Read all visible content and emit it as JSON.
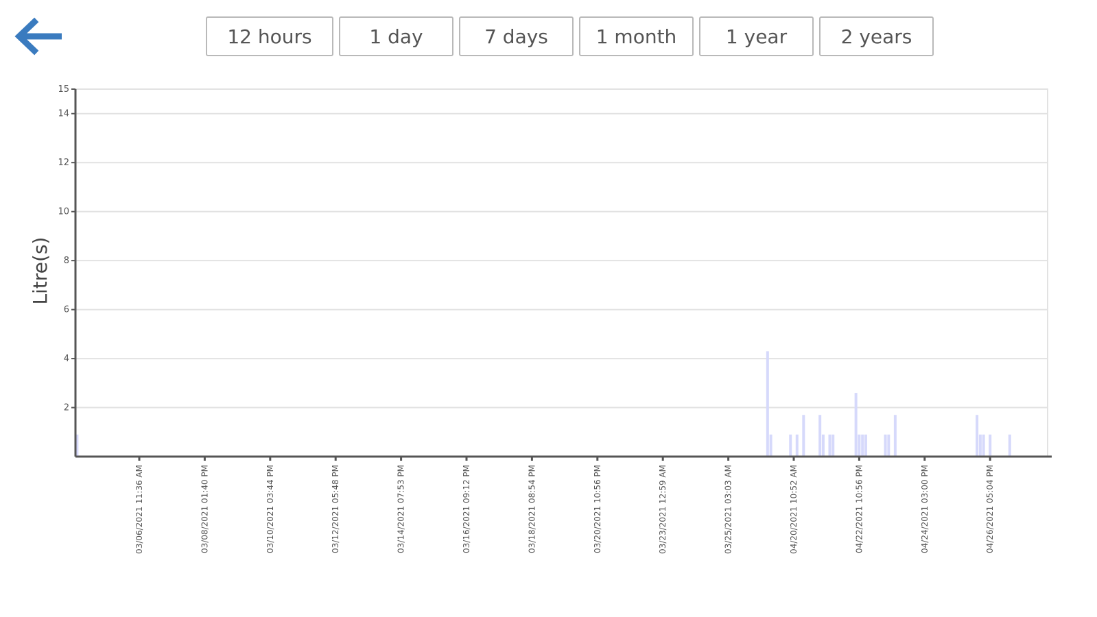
{
  "nav": {
    "back_icon": "arrow-left-icon",
    "back_color": "#3a7bbf"
  },
  "ranges": [
    {
      "label": "12 hours"
    },
    {
      "label": "1 day"
    },
    {
      "label": "7 days"
    },
    {
      "label": "1 month"
    },
    {
      "label": "1 year"
    },
    {
      "label": "2 years"
    }
  ],
  "chart_data": {
    "type": "bar",
    "ylabel": "Litre(s)",
    "ylim": [
      0,
      15
    ],
    "yticks": [
      2,
      4,
      6,
      8,
      10,
      12,
      14,
      15
    ],
    "grid": true,
    "bar_color": "#d6d9fb",
    "xticks": [
      "03/06/2021 11:36 AM",
      "03/08/2021 01:40 PM",
      "03/10/2021 03:44 PM",
      "03/12/2021 05:48 PM",
      "03/14/2021 07:53 PM",
      "03/16/2021 09:12 PM",
      "03/18/2021 08:54 PM",
      "03/20/2021 10:56 PM",
      "03/23/2021 12:59 AM",
      "03/25/2021 03:03 AM",
      "04/20/2021 10:52 AM",
      "04/22/2021 10:56 PM",
      "04/24/2021 03:00 PM",
      "04/26/2021 05:04 PM"
    ],
    "series": [
      {
        "x": [
          0.05,
          10.6,
          10.65,
          10.95,
          11.05,
          11.15,
          11.4,
          11.45,
          11.55,
          11.6,
          11.95,
          12.0,
          12.05,
          12.1,
          12.4,
          12.45,
          12.55,
          13.8,
          13.85,
          13.9,
          14.0,
          14.3
        ],
        "values": [
          0.9,
          4.3,
          0.9,
          0.9,
          0.9,
          1.7,
          1.7,
          0.9,
          0.9,
          0.9,
          2.6,
          0.9,
          0.9,
          0.9,
          0.9,
          0.9,
          1.7,
          1.7,
          0.9,
          0.9,
          0.9,
          0.9
        ]
      }
    ]
  }
}
